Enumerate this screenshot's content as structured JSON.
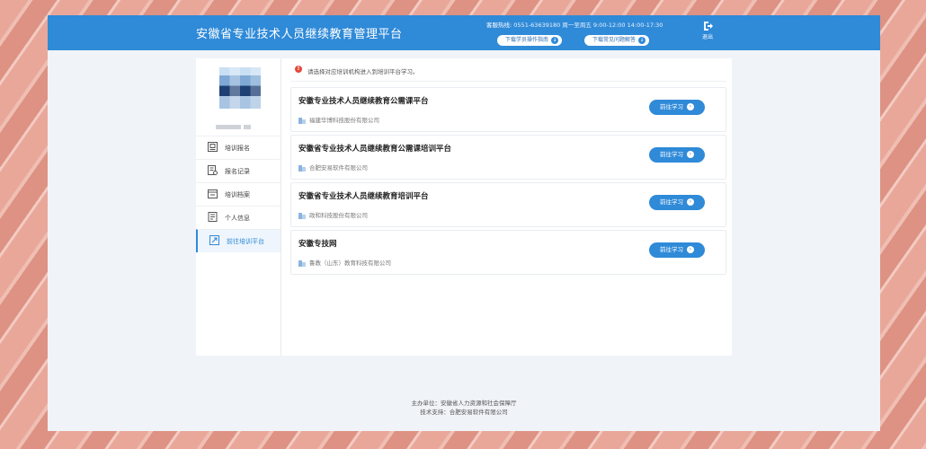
{
  "header": {
    "title": "安徽省专业技术人员继续教育管理平台",
    "hotline_label": "客服热线:",
    "hotline_value": "0551-63639180  周一至周五 9:00-12:00 14:00-17:30",
    "download_guide": "下载学员操作指南",
    "download_faq": "下载常见问题解答",
    "logout_label": "退出"
  },
  "sidebar": {
    "items": [
      {
        "label": "培训报名",
        "icon": "register-icon"
      },
      {
        "label": "报名记录",
        "icon": "record-icon"
      },
      {
        "label": "培训档案",
        "icon": "archive-icon"
      },
      {
        "label": "个人信息",
        "icon": "profile-icon"
      },
      {
        "label": "前往培训平台",
        "icon": "goto-platform-icon"
      }
    ],
    "active_index": 4
  },
  "notice": "请选择对应培训机构进入到培训平台学习。",
  "platforms": [
    {
      "name": "安徽专业技术人员继续教育公需课平台",
      "org": "福建华博科技股份有限公司",
      "button": "前往学习"
    },
    {
      "name": "安徽省专业技术人员继续教育公需课培训平台",
      "org": "合肥安易软件有限公司",
      "button": "前往学习"
    },
    {
      "name": "安徽省专业技术人员继续教育培训平台",
      "org": "政和科技股份有限公司",
      "button": "前往学习"
    },
    {
      "name": "安徽专技网",
      "org": "鲁教（山东）教育科技有限公司",
      "button": "前往学习"
    }
  ],
  "footer": {
    "host": "主办单位：安徽省人力资源和社会保障厅",
    "support": "技术支持：合肥安易软件有限公司"
  },
  "colors": {
    "primary": "#2f8ad8",
    "warning": "#e5493a"
  }
}
